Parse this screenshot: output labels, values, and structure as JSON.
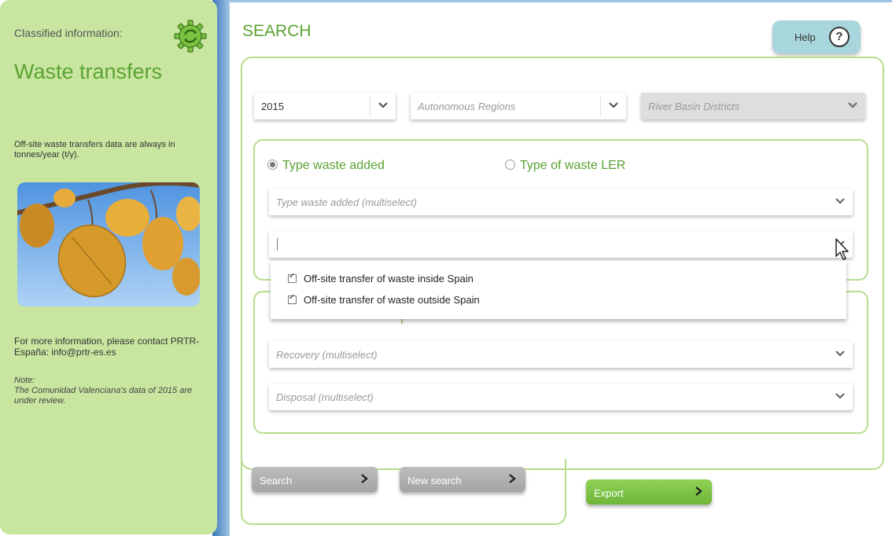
{
  "sidebar": {
    "classified_label": "Classified information:",
    "title": "Waste transfers",
    "units_text": "Off-site waste transfers data are always in tonnes/year (t/y).",
    "contact_text": "For more information, please contact PRTR-España: info@prtr-es.es",
    "note_label": "Note:",
    "note_text": "The Comunidad Valenciana's data of 2015 are under review."
  },
  "header": {
    "title": "SEARCH",
    "help_label": "Help",
    "help_icon_glyph": "?"
  },
  "filters": {
    "year": "2015",
    "region_placeholder": "Autonomous Regions",
    "basin_placeholder": "River Basin Districts"
  },
  "waste_type": {
    "radio_added": "Type waste added",
    "radio_ler": "Type of waste LER",
    "selected": "Type waste added",
    "multiselect_placeholder": "Type waste added (multiselect)"
  },
  "transfer_dropdown": {
    "input_value": "",
    "options": [
      {
        "label": "Off-site transfer of waste inside Spain",
        "checked": true
      },
      {
        "label": "Off-site transfer of waste outside Spain",
        "checked": true
      }
    ]
  },
  "treatment": {
    "recovery_placeholder": "Recovery (multiselect)",
    "disposal_placeholder": "Disposal (multiselect)"
  },
  "actions": {
    "search": "Search",
    "new_search": "New search",
    "export": "Export"
  },
  "colors": {
    "sidebar_bg": "#c8e6a0",
    "accent_green": "#5ba332",
    "panel_border": "#b5dc8b",
    "help_bg": "#a7d6dc"
  }
}
